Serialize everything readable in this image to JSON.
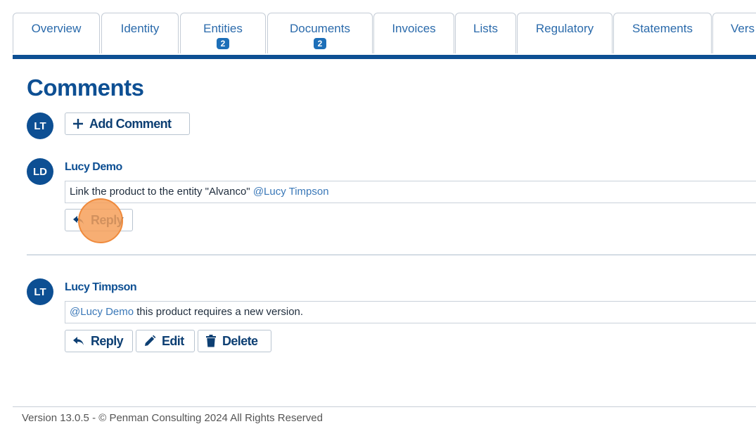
{
  "tabs": [
    {
      "label": "Overview",
      "badge": ""
    },
    {
      "label": "Identity",
      "badge": ""
    },
    {
      "label": "Entities",
      "badge": "2"
    },
    {
      "label": "Documents",
      "badge": "2"
    },
    {
      "label": "Invoices",
      "badge": ""
    },
    {
      "label": "Lists",
      "badge": ""
    },
    {
      "label": "Regulatory",
      "badge": ""
    },
    {
      "label": "Statements",
      "badge": ""
    },
    {
      "label": "Vers",
      "badge": ""
    }
  ],
  "comments_section": {
    "title": "Comments",
    "current_user_initials": "LT",
    "add_comment_label": "Add Comment"
  },
  "comments": [
    {
      "author": "Lucy Demo",
      "initials": "LD",
      "text_before": "Link the product to the entity \"Alvanco\" ",
      "mention": "@Lucy Timpson",
      "text_after": "",
      "reply_label": "Reply"
    },
    {
      "author": "Lucy Timpson",
      "initials": "LT",
      "text_before": "",
      "mention": "@Lucy Demo",
      "text_after": " this product requires a new version.",
      "reply_label": "Reply",
      "edit_label": "Edit",
      "delete_label": "Delete"
    }
  ],
  "footer": "Version 13.0.5 - © Penman Consulting 2024 All Rights Reserved",
  "colors": {
    "brand": "#0d4f93",
    "link": "#2a6aab",
    "highlight": "#f6a05a"
  }
}
